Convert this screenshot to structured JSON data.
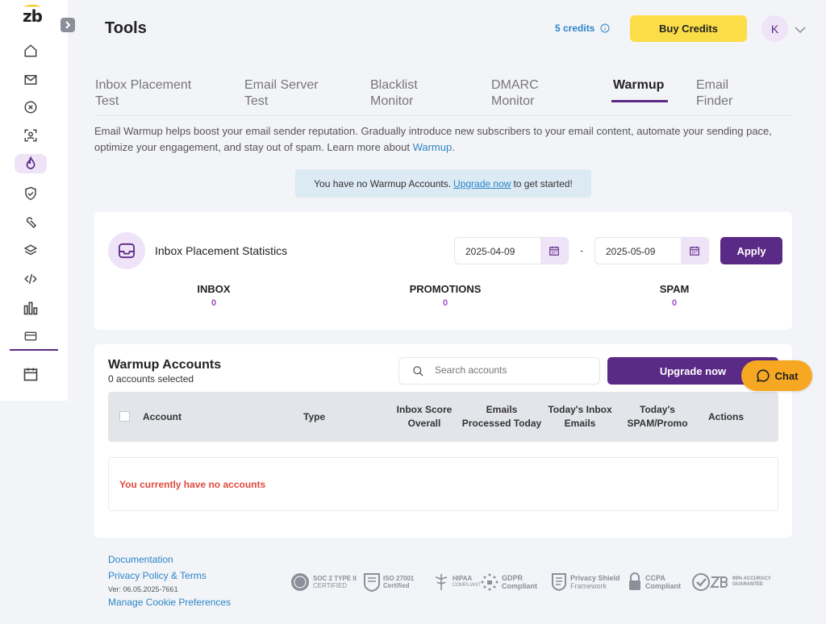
{
  "app": {
    "logo_text": "zb",
    "page_title": "Tools",
    "credits": "5 credits",
    "buy_credits_label": "Buy Credits",
    "avatar_initial": "K"
  },
  "sidebar": {
    "items": [
      {
        "name": "home",
        "icon": "home-icon"
      },
      {
        "name": "email",
        "icon": "envelope-icon"
      },
      {
        "name": "validation",
        "icon": "x-circle-icon"
      },
      {
        "name": "contact",
        "icon": "contact-scan-icon"
      },
      {
        "name": "warmup",
        "icon": "flame-icon",
        "active": true
      },
      {
        "name": "security",
        "icon": "shield-check-icon"
      },
      {
        "name": "tools",
        "icon": "wrench-icon"
      },
      {
        "name": "integrations",
        "icon": "layers-icon"
      },
      {
        "name": "api",
        "icon": "code-icon"
      },
      {
        "name": "analytics",
        "icon": "bar-chart-icon"
      },
      {
        "name": "billing",
        "icon": "credit-card-icon"
      },
      {
        "name": "calendar",
        "icon": "calendar-icon"
      }
    ]
  },
  "tabs": [
    {
      "line1": "Inbox Placement",
      "line2": "Test"
    },
    {
      "line1": "Email Server",
      "line2": "Test"
    },
    {
      "line1": "Blacklist",
      "line2": "Monitor"
    },
    {
      "line1": "DMARC",
      "line2": "Monitor"
    },
    {
      "line1": "Warmup",
      "line2": ""
    },
    {
      "line1": "Email",
      "line2": "Finder"
    }
  ],
  "description": {
    "text": "Email Warmup helps boost your email sender reputation. Gradually introduce new subscribers to your email content, automate your sending pace, optimize your engagement, and stay out of spam. Learn more about",
    "link": "Warmup",
    "end": "."
  },
  "notice": {
    "before": "You have no Warmup Accounts.",
    "link": "Upgrade now",
    "after": "to get started!"
  },
  "stats": {
    "title": "Inbox Placement Statistics",
    "date_from": "2025-04-09",
    "date_sep": "-",
    "date_to": "2025-05-09",
    "apply_label": "Apply",
    "inbox_label": "INBOX",
    "inbox_value": "0",
    "promotions_label": "PROMOTIONS",
    "promotions_value": "0",
    "spam_label": "SPAM",
    "spam_value": "0"
  },
  "accounts": {
    "title": "Warmup Accounts",
    "selected": "0 accounts selected",
    "search_placeholder": "Search accounts",
    "upgrade_label": "Upgrade now",
    "columns": {
      "account": "Account",
      "type": "Type",
      "inbox_score_1": "Inbox Score",
      "inbox_score_2": "Overall",
      "emails_processed_1": "Emails",
      "emails_processed_2": "Processed Today",
      "todays_inbox_1": "Today's Inbox",
      "todays_inbox_2": "Emails",
      "todays_spam_1": "Today's",
      "todays_spam_2": "SPAM/Promo",
      "actions": "Actions"
    },
    "empty_message": "You currently have no accounts"
  },
  "chat": {
    "label": "Chat"
  },
  "footer": {
    "documentation": "Documentation",
    "privacy": "Privacy Policy & Terms",
    "version": "Ver: 06.05.2025-7661",
    "cookies": "Manage Cookie Preferences",
    "badges": {
      "soc_1": "SOC 2 TYPE II",
      "soc_2": "CERTIFIED",
      "iso_1": "ISO 27001",
      "iso_2": "Certified",
      "hipaa_1": "HIPAA",
      "hipaa_2": "COMPLIANT",
      "gdpr_1": "GDPR",
      "gdpr_2": "Compliant",
      "shield_1": "Privacy Shield",
      "shield_2": "Framework",
      "ccpa_1": "CCPA",
      "ccpa_2": "Compliant",
      "zb_1": "99% ACCURACY",
      "zb_2": "GUARANTEE"
    }
  },
  "colors": {
    "brand_purple": "#5b2a86",
    "light_purple": "#efe3f7",
    "yellow": "#fbde47",
    "chat_orange": "#f7a823",
    "link_blue": "#2a86c9",
    "error_red": "#e04a3f"
  }
}
